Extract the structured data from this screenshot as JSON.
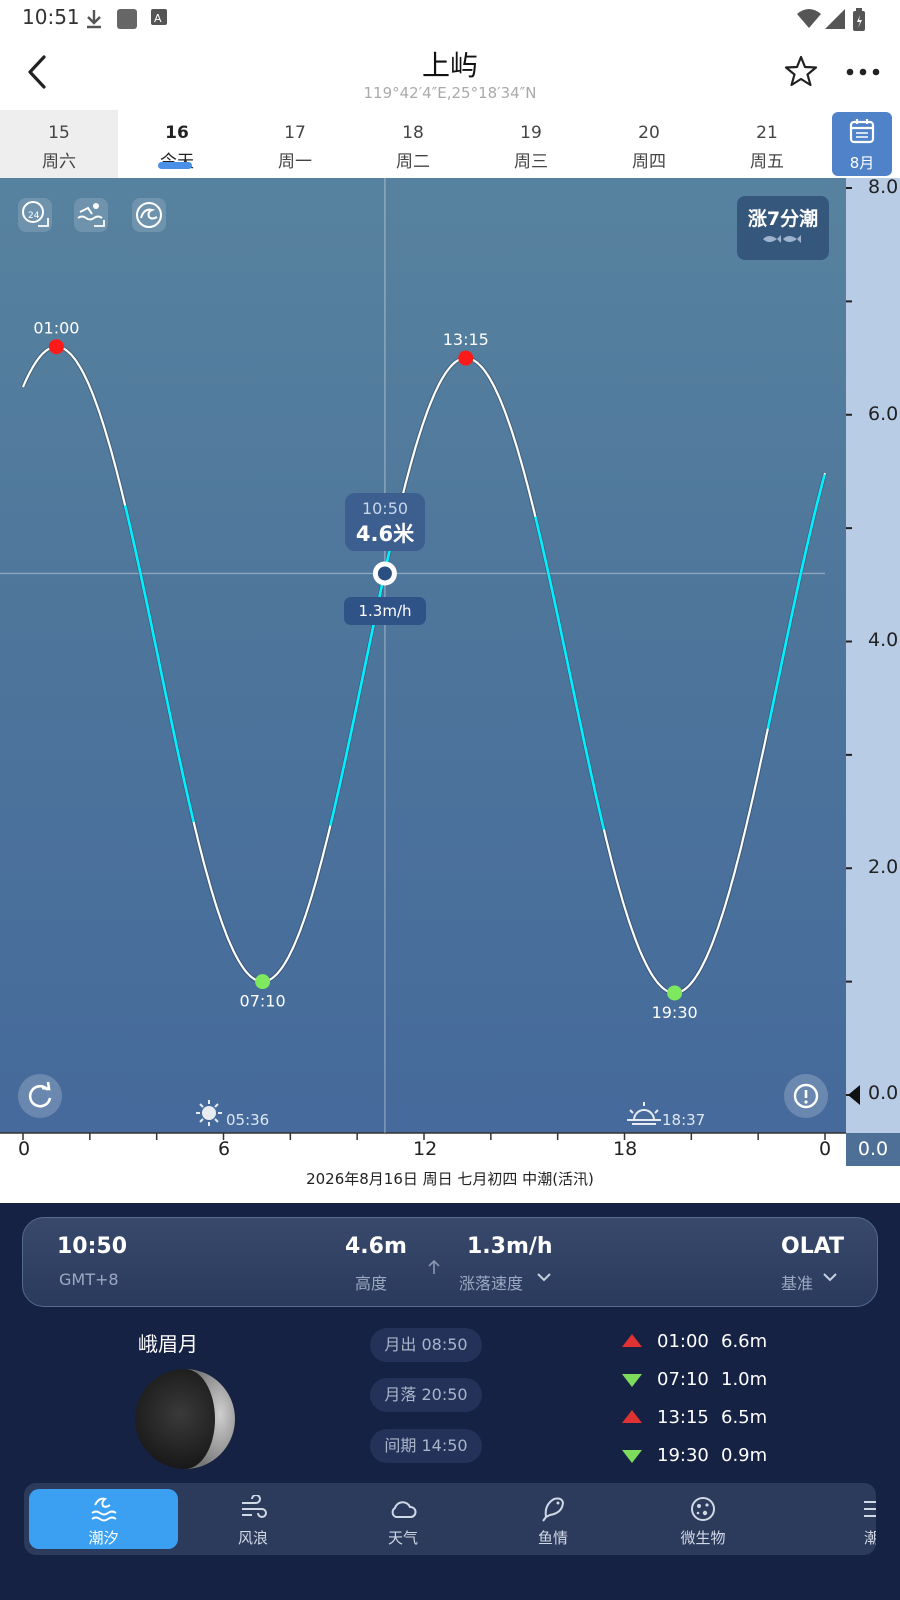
{
  "status_bar": {
    "time": "10:51"
  },
  "header": {
    "title": "上屿",
    "coords": "119°42′4″E,25°18′34″N"
  },
  "date_tabs": [
    {
      "day": "15",
      "weekday": "周六"
    },
    {
      "day": "16",
      "weekday": "今天"
    },
    {
      "day": "17",
      "weekday": "周一"
    },
    {
      "day": "18",
      "weekday": "周二"
    },
    {
      "day": "19",
      "weekday": "周三"
    },
    {
      "day": "20",
      "weekday": "周四"
    },
    {
      "day": "21",
      "weekday": "周五"
    }
  ],
  "calendar_button": {
    "label": "8月"
  },
  "chart_badge": {
    "label": "涨7分潮"
  },
  "tooltip": {
    "time": "10:50",
    "height": "4.6米",
    "speed": "1.3m/h"
  },
  "sun": {
    "sunrise": "05:36",
    "sunset": "18:37"
  },
  "date_caption": "2026年8月16日 周日 七月初四 中潮(活汛)",
  "info_card": {
    "time": "10:50",
    "timezone": "GMT+8",
    "height_value": "4.6m",
    "height_label": "高度",
    "speed_value": "1.3m/h",
    "speed_label": "涨落速度",
    "datum_value": "OLAT",
    "datum_label": "基准"
  },
  "moon": {
    "phase_name": "峨眉月",
    "moonrise": "月出 08:50",
    "moonset": "月落 20:50",
    "interval": "间期 14:50"
  },
  "tide_events": [
    {
      "type": "high",
      "time": "01:00",
      "height": "6.6m"
    },
    {
      "type": "low",
      "time": "07:10",
      "height": "1.0m"
    },
    {
      "type": "high",
      "time": "13:15",
      "height": "6.5m"
    },
    {
      "type": "low",
      "time": "19:30",
      "height": "0.9m"
    }
  ],
  "bottom_nav": [
    {
      "label": "潮汐",
      "icon": "waves-icon"
    },
    {
      "label": "风浪",
      "icon": "wind-icon"
    },
    {
      "label": "天气",
      "icon": "cloud-icon"
    },
    {
      "label": "鱼情",
      "icon": "fish-icon"
    },
    {
      "label": "微生物",
      "icon": "microbe-icon"
    },
    {
      "label": "潮",
      "icon": "menu-icon"
    }
  ],
  "chart_data": {
    "type": "line",
    "x_axis": {
      "min": 0,
      "max": 24,
      "ticks": [
        "0",
        "6",
        "12",
        "18",
        "0"
      ]
    },
    "y_axis": {
      "min": 0,
      "max": 8,
      "ticks": [
        "8.0",
        "6.0",
        "4.0",
        "2.0",
        "0.0",
        "0.0"
      ]
    },
    "extrema": [
      {
        "label": "01:00",
        "hour": 1.0,
        "height": 6.6,
        "kind": "high"
      },
      {
        "label": "07:10",
        "hour": 7.17,
        "height": 1.0,
        "kind": "low"
      },
      {
        "label": "13:15",
        "hour": 13.25,
        "height": 6.5,
        "kind": "high"
      },
      {
        "label": "19:30",
        "hour": 19.5,
        "height": 0.9,
        "kind": "low"
      }
    ],
    "start": {
      "hour": 0,
      "height": 6.2
    },
    "end": {
      "hour": 24,
      "height": 5.4
    },
    "cursor": {
      "hour": 10.83,
      "height": 4.6
    },
    "sunrise_hour": 5.6,
    "sunset_hour": 18.62,
    "colors": {
      "curve": "#ffffff",
      "fast_segment": "#00f0ff",
      "high": "#ff1a1a",
      "low": "#7ee85f"
    }
  }
}
